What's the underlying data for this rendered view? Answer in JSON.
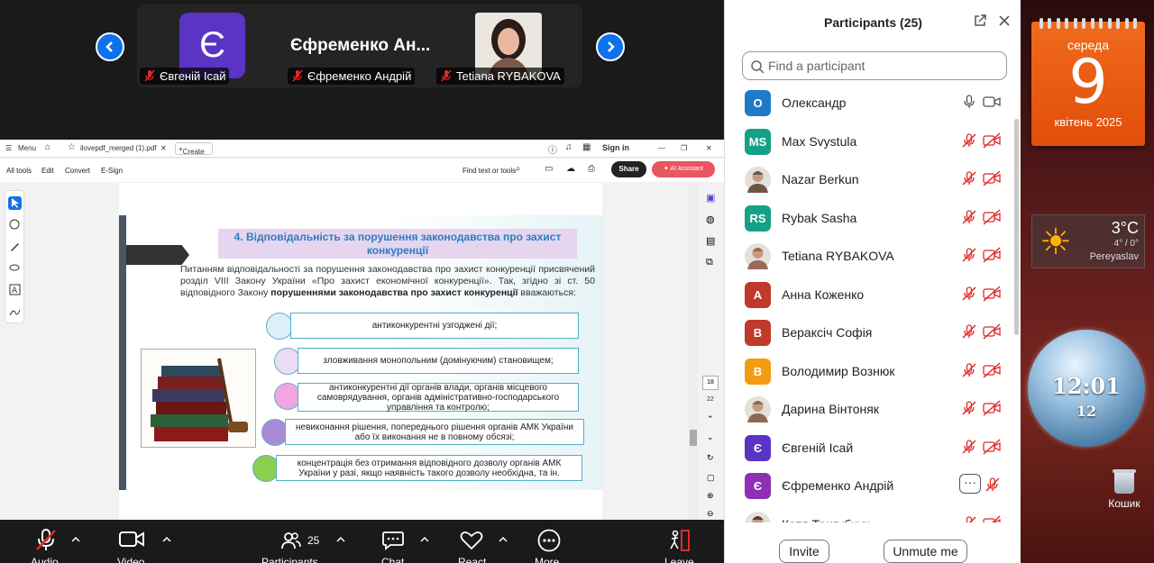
{
  "meeting": {
    "video_tiles": [
      {
        "avatar_letter": "Є",
        "label": "Євгеній Ісай"
      },
      {
        "big_name": "Єфременко  Ан...",
        "label": "Єфременко Андрій"
      },
      {
        "label": "Tetiana RYBAKOVA"
      }
    ],
    "toolbar": {
      "audio": "Audio",
      "video": "Video",
      "participants": "Participants",
      "participants_count": "25",
      "chat": "Chat",
      "react": "React",
      "more": "More",
      "leave": "Leave"
    }
  },
  "pdf_viewer": {
    "menu": "Menu",
    "tab_name": "ilovepdf_merged (1).pdf",
    "create": "Create",
    "sign_in": "Sign in",
    "toolbar": [
      "All tools",
      "Edit",
      "Convert",
      "E-Sign"
    ],
    "find": "Find text or tools",
    "share": "Share",
    "ai_assistant": "AI Assistant",
    "page_current": "18",
    "page_total": "22",
    "slide": {
      "title": "4. Відповідальність за порушення законодавства про захист конкуренції",
      "intro_1": "Питанням відповідальності за порушення законодавства про захист конкуренції присвячений розділ VIII Закону України «Про захист економічної конкуренції». Так, згідно зі ст. 50 відповідного Закону ",
      "intro_bold": "порушеннями законодавства про захист конкуренції",
      "intro_2": " вважаються:",
      "items": [
        "антиконкурентні узгоджені дії;",
        "зловживання монопольним (домінуючим) становищем;",
        "антиконкурентні дії органів влади, органів місцевого самоврядування, органів адміністративно-господарського управління та контролю;",
        "невиконання рішення, попереднього рішення органів АМК України або їх виконання не в повному обсязі;",
        "концентрація без отримання відповідного дозволу органів АМК України у разі, якщо наявність такого дозволу необхідна, та ін."
      ]
    }
  },
  "participants_panel": {
    "title": "Participants (25)",
    "search_placeholder": "Find a participant",
    "participants": [
      {
        "initials": "О",
        "name": "Олександр",
        "color": "#1e7bc8"
      },
      {
        "initials": "MS",
        "name": "Max Svystula",
        "color": "#16a085"
      },
      {
        "initials": "",
        "name": "Nazar Berkun",
        "photo": true
      },
      {
        "initials": "RS",
        "name": "Rybak Sasha",
        "color": "#16a085"
      },
      {
        "initials": "",
        "name": "Tetiana RYBAKOVA",
        "photo": true
      },
      {
        "initials": "А",
        "name": "Анна Коженко",
        "color": "#c0392b"
      },
      {
        "initials": "В",
        "name": "Вераксіч Софія",
        "color": "#c0392b"
      },
      {
        "initials": "В",
        "name": "Володимир Вознюк",
        "color": "#f39c12"
      },
      {
        "initials": "",
        "name": "Дарина Вінтоняк",
        "photo": true
      },
      {
        "initials": "Є",
        "name": "Євгеній Ісай",
        "color": "#5b33c5"
      },
      {
        "initials": "Є",
        "name": "Єфременко Андрій",
        "color": "#8e2fb5"
      },
      {
        "initials": "",
        "name": "Катя Тригубчук",
        "photo": true
      }
    ],
    "more_label": "···",
    "invite": "Invite",
    "unmute_me": "Unmute me"
  },
  "desktop": {
    "calendar": {
      "weekday": "середа",
      "day": "9",
      "month_year": "квітень 2025"
    },
    "weather": {
      "temp": "3°C",
      "range": "4° / 0°",
      "city": "Pereyaslav"
    },
    "clock": {
      "time": "12:01",
      "date": "12"
    },
    "recycle_bin": "Кошик"
  },
  "colors": {
    "accent": "#0e72ed",
    "muted_red": "#e02828",
    "calendar": "#e85a14"
  },
  "icons": [
    "chevron-left-icon",
    "chevron-right-icon",
    "mic-muted-icon",
    "camera-off-icon",
    "search-icon",
    "popout-icon",
    "close-icon",
    "chat-icon",
    "heart-icon",
    "leave-icon"
  ]
}
